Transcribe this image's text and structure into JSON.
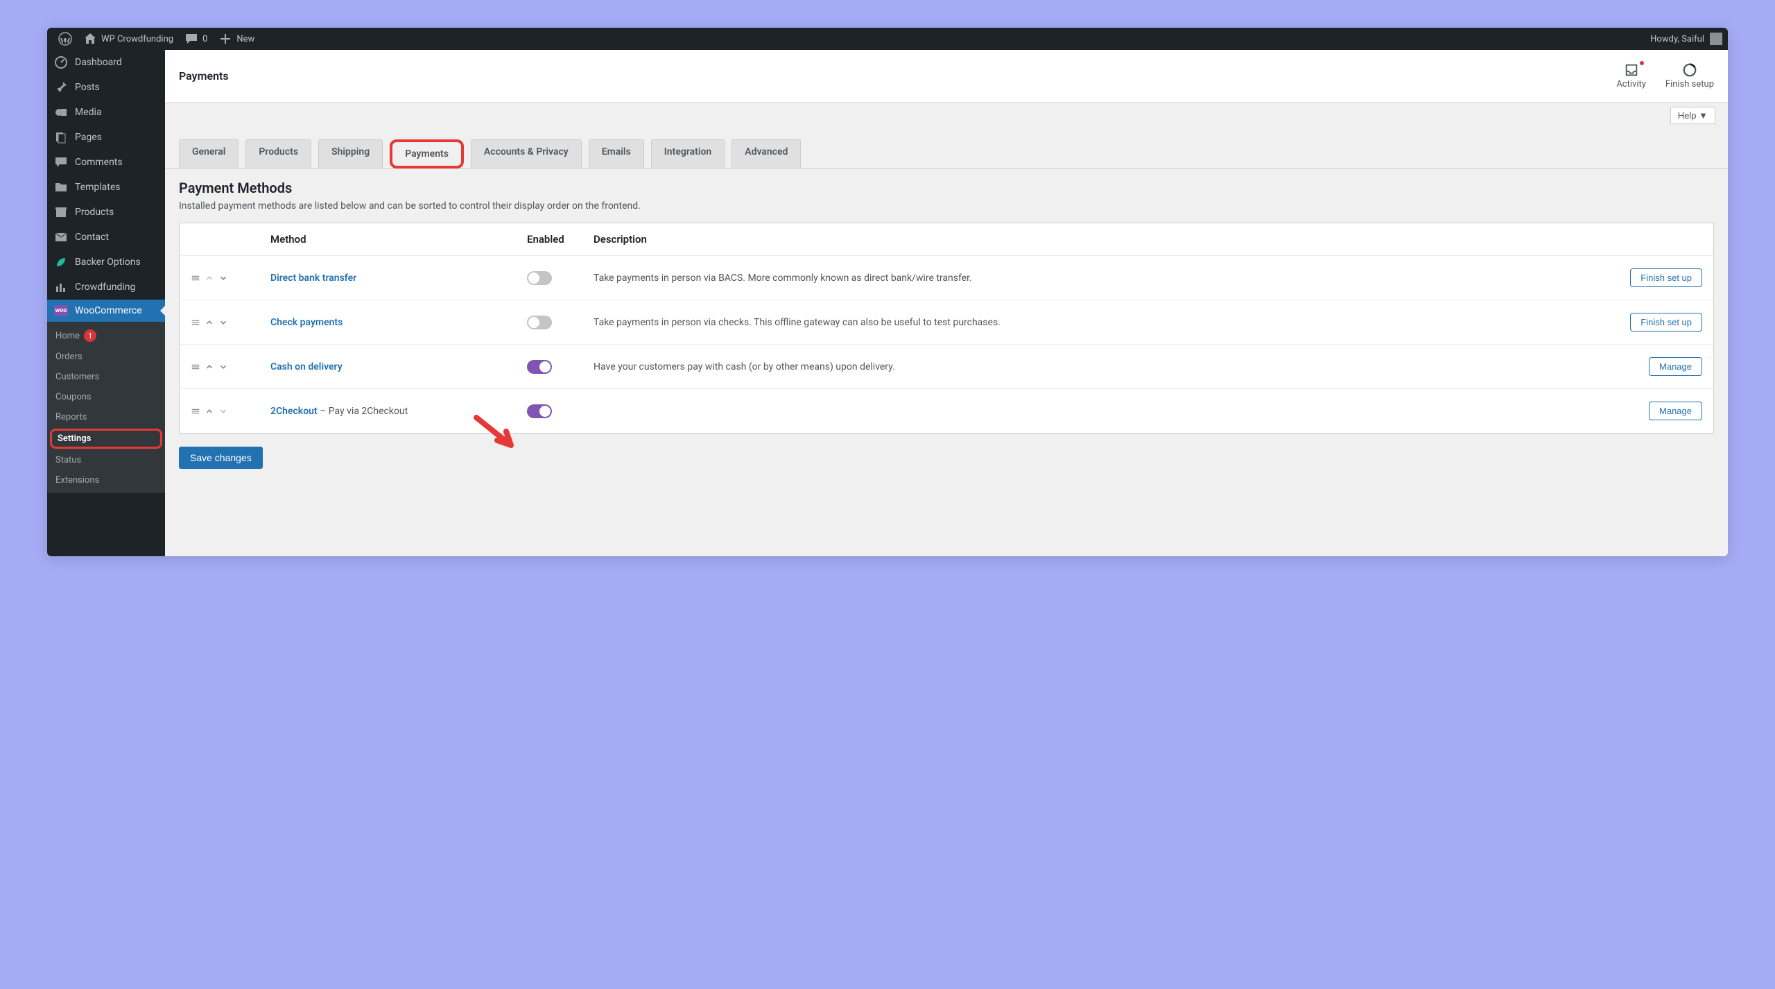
{
  "adminbar": {
    "site_name": "WP Crowdfunding",
    "comments_count": "0",
    "new_label": "New",
    "howdy": "Howdy, Saiful"
  },
  "sidebar": {
    "items": [
      {
        "label": "Dashboard",
        "icon": "dashboard"
      },
      {
        "label": "Posts",
        "icon": "pin"
      },
      {
        "label": "Media",
        "icon": "media"
      },
      {
        "label": "Pages",
        "icon": "pages"
      },
      {
        "label": "Comments",
        "icon": "comment"
      },
      {
        "label": "Templates",
        "icon": "folder"
      },
      {
        "label": "Products",
        "icon": "archive"
      },
      {
        "label": "Contact",
        "icon": "mail"
      },
      {
        "label": "Backer Options",
        "icon": "leaf"
      },
      {
        "label": "Crowdfunding",
        "icon": "chart"
      },
      {
        "label": "WooCommerce",
        "icon": "woo"
      }
    ],
    "submenu": [
      {
        "label": "Home",
        "badge": "1"
      },
      {
        "label": "Orders"
      },
      {
        "label": "Customers"
      },
      {
        "label": "Coupons"
      },
      {
        "label": "Reports"
      },
      {
        "label": "Settings",
        "active": true,
        "highlighted": true
      },
      {
        "label": "Status"
      },
      {
        "label": "Extensions"
      }
    ]
  },
  "header": {
    "title": "Payments",
    "activity": "Activity",
    "finish_setup": "Finish setup"
  },
  "help_label": "Help ▼",
  "tabs": [
    "General",
    "Products",
    "Shipping",
    "Payments",
    "Accounts & Privacy",
    "Emails",
    "Integration",
    "Advanced"
  ],
  "active_tab": "Payments",
  "section": {
    "title": "Payment Methods",
    "desc": "Installed payment methods are listed below and can be sorted to control their display order on the frontend."
  },
  "table": {
    "headers": {
      "method": "Method",
      "enabled": "Enabled",
      "description": "Description"
    },
    "rows": [
      {
        "method": "Direct bank transfer",
        "suffix": "",
        "enabled": false,
        "description": "Take payments in person via BACS. More commonly known as direct bank/wire transfer.",
        "action": "Finish set up"
      },
      {
        "method": "Check payments",
        "suffix": "",
        "enabled": false,
        "description": "Take payments in person via checks. This offline gateway can also be useful to test purchases.",
        "action": "Finish set up"
      },
      {
        "method": "Cash on delivery",
        "suffix": "",
        "enabled": true,
        "description": "Have your customers pay with cash (or by other means) upon delivery.",
        "action": "Manage"
      },
      {
        "method": "2Checkout",
        "suffix": " – Pay via 2Checkout",
        "enabled": true,
        "description": "",
        "action": "Manage"
      }
    ]
  },
  "save_label": "Save changes"
}
